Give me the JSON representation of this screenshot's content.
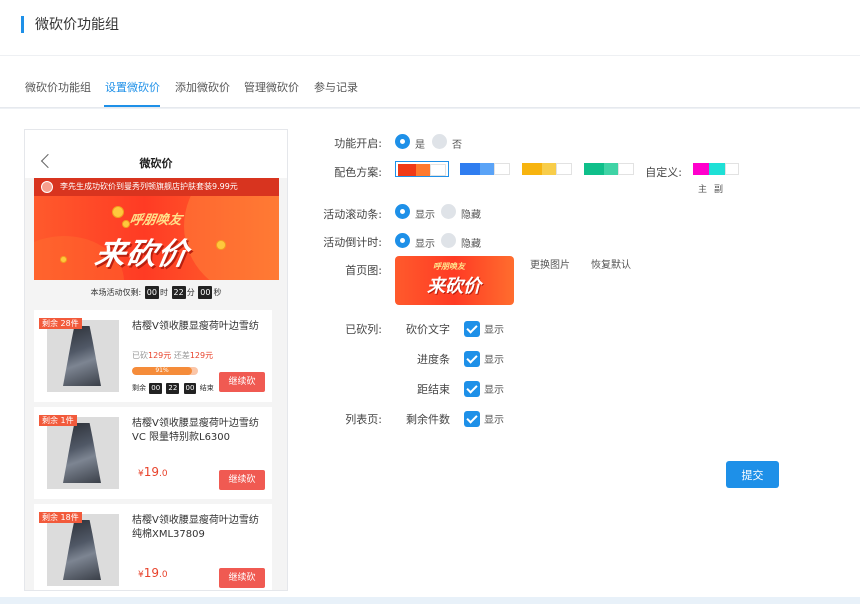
{
  "header": {
    "title": "微砍价功能组"
  },
  "tabs": [
    {
      "label": "微砍价功能组"
    },
    {
      "label": "设置微砍价"
    },
    {
      "label": "添加微砍价"
    },
    {
      "label": "管理微砍价"
    },
    {
      "label": "参与记录"
    }
  ],
  "active_tab": 1,
  "preview": {
    "title": "微砍价",
    "ticker": "李先生成功砍价到曼秀列顿旗舰店护肤套装9.99元",
    "banner_sub": "呼朋唤友",
    "banner_main": "来砍价",
    "countdown": {
      "prefix": "本场活动仅剩:",
      "h": "00",
      "h_unit": "时",
      "m": "22",
      "m_unit": "分",
      "s": "00",
      "s_unit": "秒"
    },
    "continue_label": "继续砍",
    "cards": [
      {
        "badge": "剩余 28件",
        "name": "桔樱V领收腰显瘦荷叶边雪纺",
        "cut_label": "已砍",
        "cut_value": "129元",
        "left_label": "还差",
        "left_value": "129元",
        "progress_text": "91%",
        "progress": 0.91,
        "remain_label": "剩余",
        "remain_h": "00",
        "remain_m": "22",
        "remain_s": "00",
        "remain_suffix": "结束"
      },
      {
        "badge": "剩余 1件",
        "name": "桔樱V领收腰显瘦荷叶边雪纺VC 限量特别款L6300",
        "price_symbol": "¥",
        "price_int": "19",
        "price_dec": ".0"
      },
      {
        "badge": "剩余 18件",
        "name": "桔樱V领收腰显瘦荷叶边雪纺纯棉XML37809",
        "price_symbol": "¥",
        "price_int": "19",
        "price_dec": ".0"
      }
    ]
  },
  "form": {
    "enable": {
      "label": "功能开启:",
      "yes": "是",
      "no": "否",
      "value": "yes"
    },
    "color": {
      "label": "配色方案:",
      "custom_label": "自定义:",
      "main": "主",
      "sub": "副",
      "selected": 0,
      "schemes": [
        {
          "primary": "#f03a17",
          "secondary": "#ff7a2e"
        },
        {
          "primary": "#2f7df0",
          "secondary": "#5aa3f7"
        },
        {
          "primary": "#f7b40f",
          "secondary": "#f8cd4a"
        },
        {
          "primary": "#0fbf8a",
          "secondary": "#3fd3a5"
        }
      ],
      "custom": {
        "primary": "#ff00cc",
        "secondary": "#1ee0d6"
      }
    },
    "scroll": {
      "label": "活动滚动条:",
      "show": "显示",
      "hide": "隐藏",
      "value": "show"
    },
    "countdown": {
      "label": "活动倒计时:",
      "show": "显示",
      "hide": "隐藏",
      "value": "show"
    },
    "homepage": {
      "label": "首页图:",
      "change": "更换图片",
      "reset": "恢复默认"
    },
    "bargained": {
      "label": "已砍列:",
      "items": [
        {
          "label": "砍价文字",
          "check": "显示",
          "checked": true
        },
        {
          "label": "进度条",
          "check": "显示",
          "checked": true
        },
        {
          "label": "距结束",
          "check": "显示",
          "checked": true
        }
      ]
    },
    "listpage": {
      "label": "列表页:",
      "items": [
        {
          "label": "剩余件数",
          "check": "显示",
          "checked": true
        }
      ]
    },
    "submit_label": "提交"
  }
}
